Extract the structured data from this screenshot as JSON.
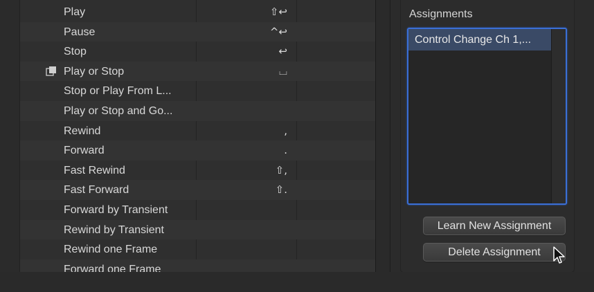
{
  "commands": [
    {
      "label": "Play",
      "key": "⇧↩",
      "icon": false
    },
    {
      "label": "Pause",
      "key": "^↩",
      "icon": false
    },
    {
      "label": "Stop",
      "key": "↩",
      "icon": false
    },
    {
      "label": "Play or Stop",
      "key": "⌴",
      "icon": true
    },
    {
      "label": "Stop or Play From L...",
      "key": "",
      "icon": false
    },
    {
      "label": "Play or Stop and Go...",
      "key": "",
      "icon": false
    },
    {
      "label": "Rewind",
      "key": ",",
      "icon": false
    },
    {
      "label": "Forward",
      "key": ".",
      "icon": false
    },
    {
      "label": "Fast Rewind",
      "key": "⇧,",
      "icon": false
    },
    {
      "label": "Fast Forward",
      "key": "⇧.",
      "icon": false
    },
    {
      "label": "Forward by Transient",
      "key": "",
      "icon": false
    },
    {
      "label": "Rewind by Transient",
      "key": "",
      "icon": false
    },
    {
      "label": "Rewind one Frame",
      "key": "",
      "icon": false
    },
    {
      "label": "Forward one Frame",
      "key": "",
      "icon": false
    }
  ],
  "assignments": {
    "title": "Assignments",
    "items": [
      "Control Change Ch 1,..."
    ],
    "learn_label": "Learn New Assignment",
    "delete_label": "Delete Assignment"
  },
  "colors": {
    "selection_border": "#3b6fd6",
    "selection_fill": "#3a4a66"
  }
}
